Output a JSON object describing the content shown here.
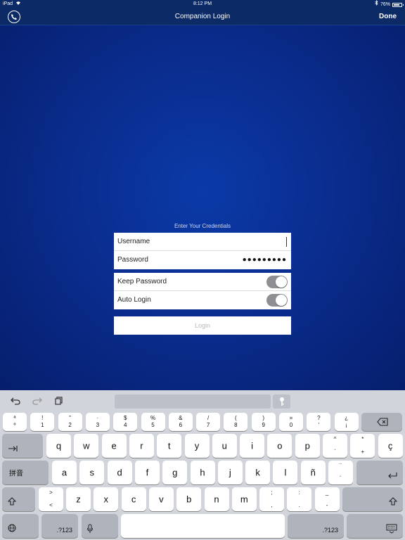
{
  "status": {
    "device": "iPad",
    "time": "8:12 PM",
    "battery": "76%",
    "battery_level": 0.76
  },
  "nav": {
    "title": "Companion Login",
    "done_label": "Done"
  },
  "form": {
    "heading": "Enter Your Credentials",
    "username_label": "Username",
    "password_label": "Password",
    "password_mask": "●●●●●●●●●",
    "keep_password_label": "Keep Password",
    "keep_password_on": true,
    "auto_login_label": "Auto Login",
    "auto_login_on": true,
    "login_label": "Login"
  },
  "keyboard": {
    "number_row": [
      {
        "top": "ª",
        "bot": "º"
      },
      {
        "top": "!",
        "bot": "1"
      },
      {
        "top": "\"",
        "bot": "2"
      },
      {
        "top": "·",
        "bot": "3"
      },
      {
        "top": "$",
        "bot": "4"
      },
      {
        "top": "%",
        "bot": "5"
      },
      {
        "top": "&",
        "bot": "6"
      },
      {
        "top": "/",
        "bot": "7"
      },
      {
        "top": "(",
        "bot": "8"
      },
      {
        "top": ")",
        "bot": "9"
      },
      {
        "top": "=",
        "bot": "0"
      },
      {
        "top": "?",
        "bot": "'"
      },
      {
        "top": "¿",
        "bot": "¡"
      }
    ],
    "row_q": [
      "q",
      "w",
      "e",
      "r",
      "t",
      "y",
      "u",
      "i",
      "o",
      "p"
    ],
    "row_q_extra": [
      {
        "top": "^",
        "bot": "`"
      },
      {
        "top": "*",
        "bot": "+"
      },
      {
        "single": "ç"
      }
    ],
    "row_a": [
      "a",
      "s",
      "d",
      "f",
      "g",
      "h",
      "j",
      "k",
      "l",
      "ñ"
    ],
    "row_a_extra": {
      "top": "¨",
      "bot": "´"
    },
    "row_z": [
      "z",
      "x",
      "c",
      "v",
      "b",
      "n",
      "m"
    ],
    "angle_key": {
      "top": ">",
      "bot": "<"
    },
    "row_z_extra": [
      {
        "top": ";",
        "bot": ","
      },
      {
        "top": ":",
        "bot": "."
      },
      {
        "top": "_",
        "bot": "-"
      }
    ],
    "pinyin_label": "拼音",
    "numbers_label": ".?123"
  }
}
